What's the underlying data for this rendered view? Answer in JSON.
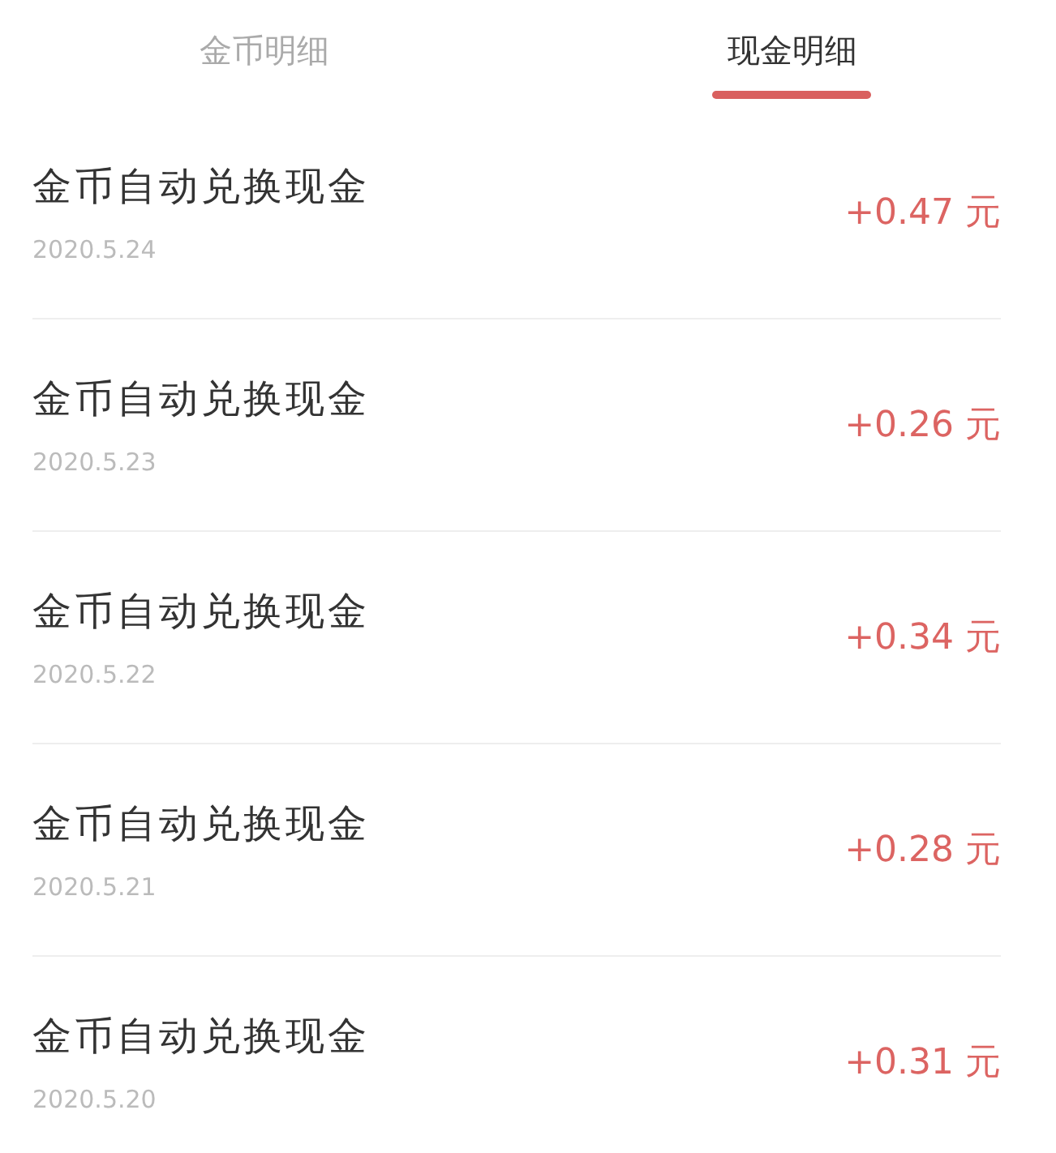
{
  "tabs": [
    {
      "label": "金币明细",
      "selected": false
    },
    {
      "label": "现金明细",
      "selected": true
    }
  ],
  "records": [
    {
      "title": "金币自动兑换现金",
      "date": "2020.5.24",
      "amount": "+0.47 元"
    },
    {
      "title": "金币自动兑换现金",
      "date": "2020.5.23",
      "amount": "+0.26 元"
    },
    {
      "title": "金币自动兑换现金",
      "date": "2020.5.22",
      "amount": "+0.34 元"
    },
    {
      "title": "金币自动兑换现金",
      "date": "2020.5.21",
      "amount": "+0.28 元"
    },
    {
      "title": "金币自动兑换现金",
      "date": "2020.5.20",
      "amount": "+0.31 元"
    }
  ]
}
